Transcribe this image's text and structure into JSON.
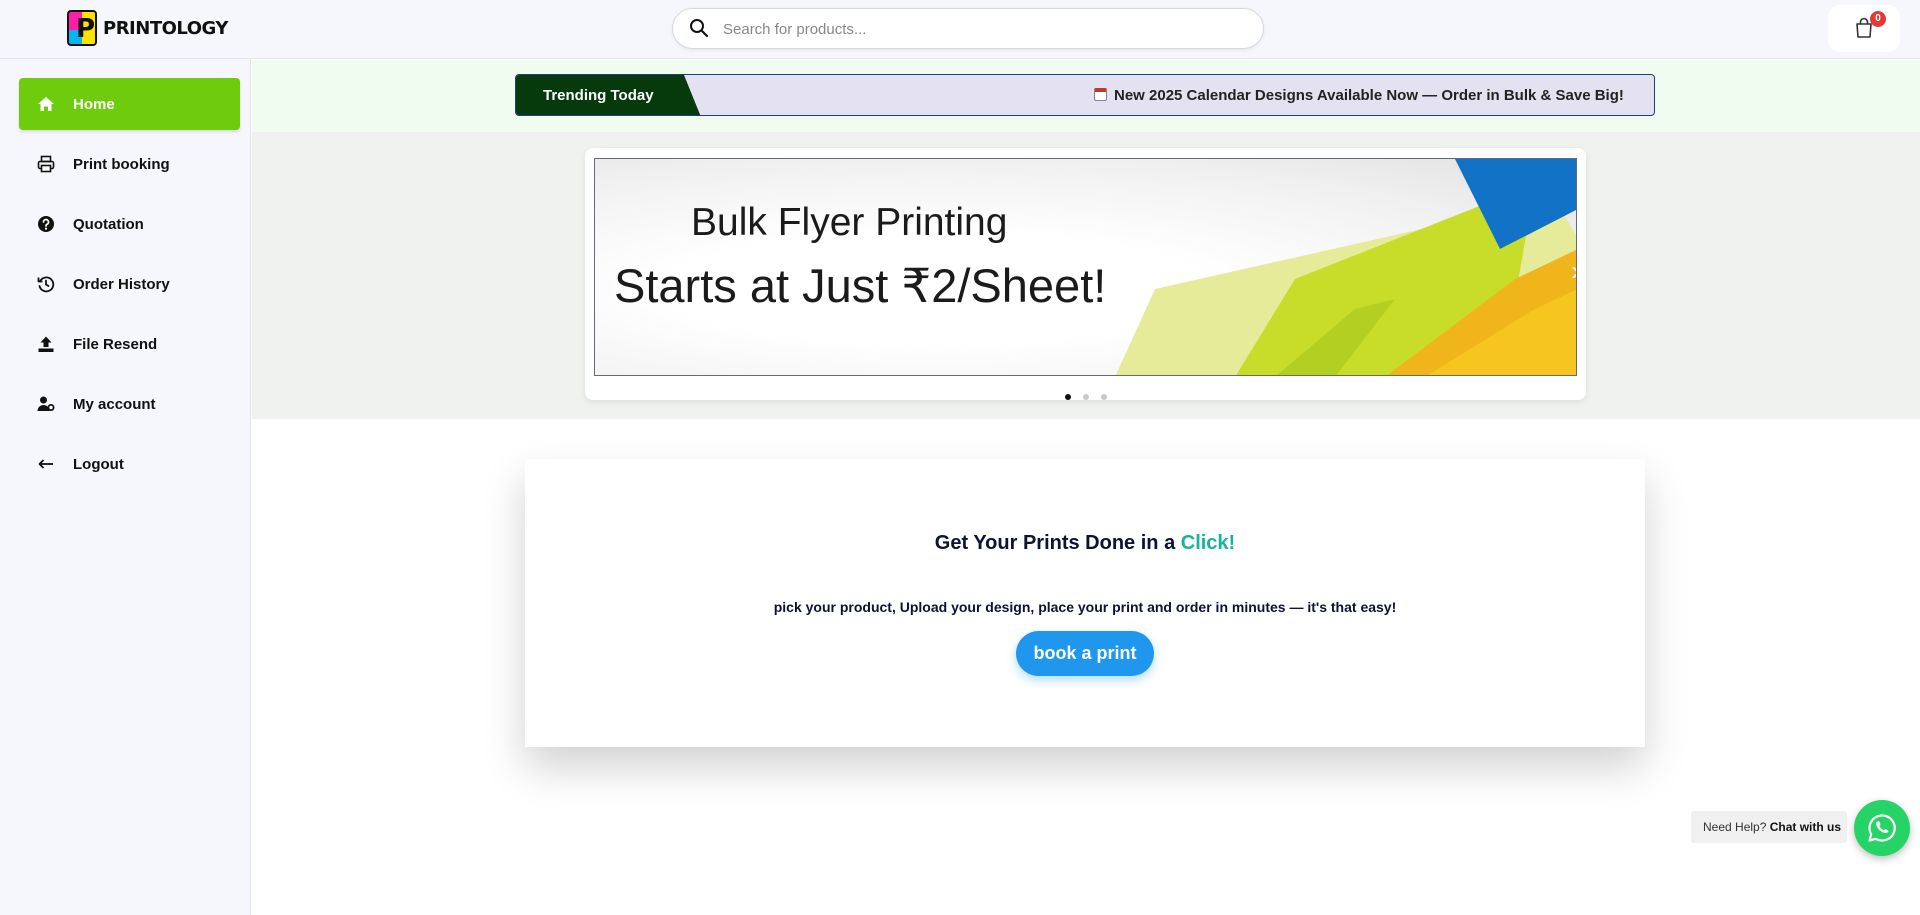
{
  "brand": {
    "name": "PRINTOLOGY"
  },
  "search": {
    "placeholder": "Search for products..."
  },
  "cart": {
    "count": "0"
  },
  "sidebar": {
    "items": [
      {
        "label": "Home",
        "icon": "home-icon",
        "active": true
      },
      {
        "label": "Print booking",
        "icon": "printer-icon"
      },
      {
        "label": "Quotation",
        "icon": "question-icon"
      },
      {
        "label": "Order History",
        "icon": "history-icon"
      },
      {
        "label": "File Resend",
        "icon": "upload-icon"
      },
      {
        "label": "My account",
        "icon": "user-cog-icon"
      },
      {
        "label": "Logout",
        "icon": "arrow-left-icon"
      }
    ]
  },
  "trending": {
    "label": "Trending Today",
    "message": "New 2025 Calendar Designs Available Now — Order in Bulk & Save Big!"
  },
  "slider": {
    "line1": "Bulk Flyer Printing",
    "line2": "Starts at Just ₹2/Sheet!",
    "next_glyph": "›",
    "dots": 3,
    "active_dot": 0
  },
  "cta": {
    "title_prefix": "Get Your Prints Done in a ",
    "title_accent": "Click!",
    "subtitle": "pick your product, Upload your design, place your print and order in minutes — it's that easy!",
    "button": "book a print"
  },
  "help": {
    "prefix": "Need Help?",
    "link": "Chat with us"
  },
  "colors": {
    "active_nav": "#6fcb0e",
    "trend_label_bg": "#063a0c",
    "accent_text": "#16b49a",
    "cta_button": "#1f97ee",
    "whatsapp": "#25d366",
    "badge": "#e53935"
  }
}
